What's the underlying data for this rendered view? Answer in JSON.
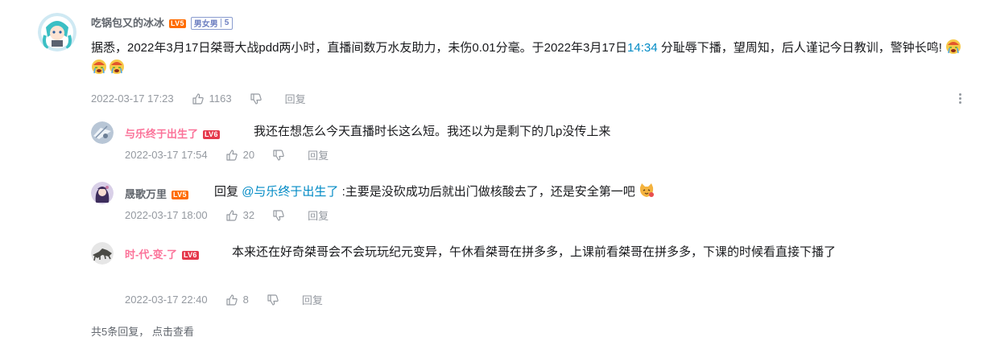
{
  "main_comment": {
    "username": "吃锅包又的冰冰",
    "level": "LV5",
    "fan_badge_name": "男女男",
    "fan_badge_level": "5",
    "text_part1": "据悉，2022年3月17日桀哥大战pdd两小时，直播间数万水友助力，未伤0.01分毫。于2022年3月17日",
    "time_link": "14:34",
    "text_part2": " 分耻辱下播，望周知，后人谨记今日教训，警钟长鸣!",
    "emojis": [
      "crying-emoji",
      "crying-emoji",
      "crying-emoji"
    ],
    "date": "2022-03-17 17:23",
    "likes": "1163",
    "reply_label": "回复"
  },
  "replies": [
    {
      "username": "与乐终于出生了",
      "level": "LV6",
      "text": "我还在想怎么今天直播时长这么短。我还以为是剩下的几p没传上来",
      "date": "2022-03-17 17:54",
      "likes": "20",
      "reply_label": "回复"
    },
    {
      "username": "晟歌万里",
      "level": "LV5",
      "reply_prefix": "回复",
      "mention": "@与乐终于出生了",
      "text": " :主要是没砍成功后就出门做核酸去了，还是安全第一吧",
      "emoji": "cat-emoji",
      "date": "2022-03-17 18:00",
      "likes": "32",
      "reply_label": "回复"
    },
    {
      "username": "时-代-变-了",
      "level": "LV6",
      "text": "本来还在好奇桀哥会不会玩玩纪元变异，午休看桀哥在拼多多，上课前看桀哥在拼多多，下课的时候看直接下播了",
      "date": "2022-03-17 22:40",
      "likes": "8",
      "reply_label": "回复"
    }
  ],
  "footer": {
    "total_text": "共5条回复，",
    "view_link": "点击查看"
  },
  "colors": {
    "level5": "#ff6c00",
    "level6": "#e5394c",
    "vip_name": "#fb7299",
    "link": "#008ac5",
    "meta": "#9499a0"
  }
}
